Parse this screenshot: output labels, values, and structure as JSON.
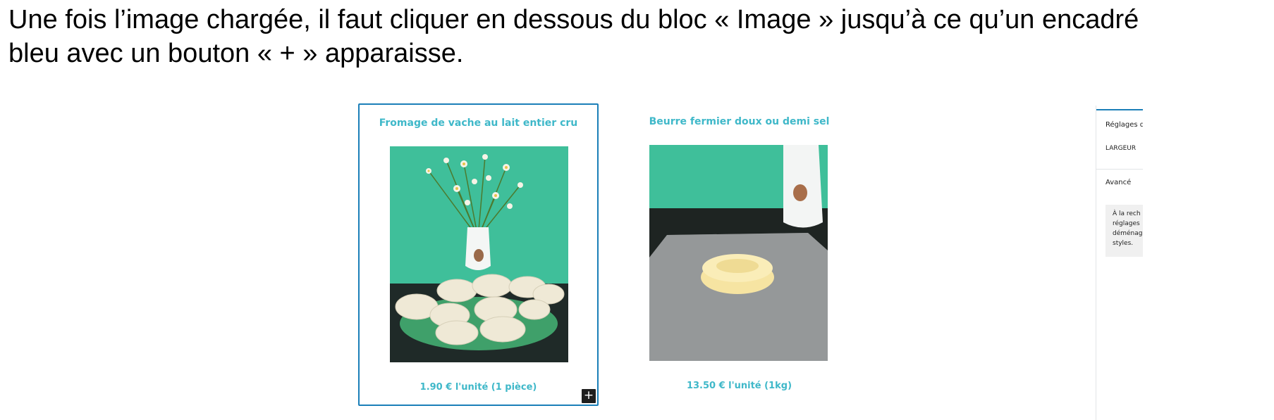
{
  "instruction": {
    "line1": "Une fois l’image chargée, il faut cliquer en dessous du bloc « Image » jusqu’à ce qu’un encadré",
    "line2": "bleu avec un bouton « + » apparaisse."
  },
  "products": [
    {
      "title": "Fromage de vache au lait entier cru",
      "price": "1.90 € l'unité (1 pièce)",
      "selected": true
    },
    {
      "title": "Beurre fermier doux ou demi sel",
      "price": "13.50 € l'unité (1kg)",
      "selected": false
    }
  ],
  "add_block_button": {
    "label": "+"
  },
  "settings_panel": {
    "heading": "Réglages d",
    "width_label": "LARGEUR",
    "advanced_label": "Avancé",
    "notice_lines": [
      "À la rech",
      "réglages",
      "déménag",
      "styles."
    ]
  },
  "colors": {
    "selection_border": "#1b7fb8",
    "product_text": "#3fb8c9",
    "plus_button_bg": "#1e1e1e"
  }
}
